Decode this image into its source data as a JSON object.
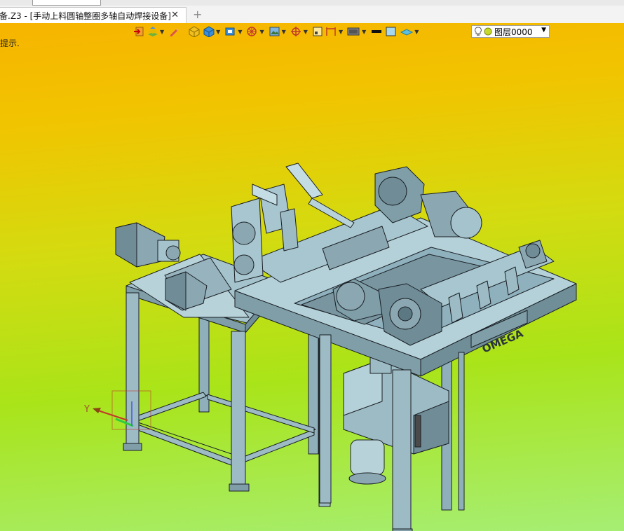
{
  "tab": {
    "title": "备.Z3 - [手动上料圆轴整圈多轴自动焊接设备]",
    "close": "✕",
    "new": "+"
  },
  "prompt": "提示.",
  "layer": {
    "label": "图层0000",
    "arrow": "▼"
  },
  "axis": {
    "y_label": "Y"
  },
  "brand_text": "OMEGA",
  "toolbar_icons": [
    "exit-icon",
    "layers-icon",
    "pen-icon",
    "cube-yellow-icon",
    "cube-blue-icon",
    "view-icon",
    "sphere-icon",
    "image-icon",
    "target-icon",
    "frame-icon",
    "dimension-icon",
    "display-icon",
    "line-color-icon",
    "fill-color-icon",
    "material-icon"
  ]
}
